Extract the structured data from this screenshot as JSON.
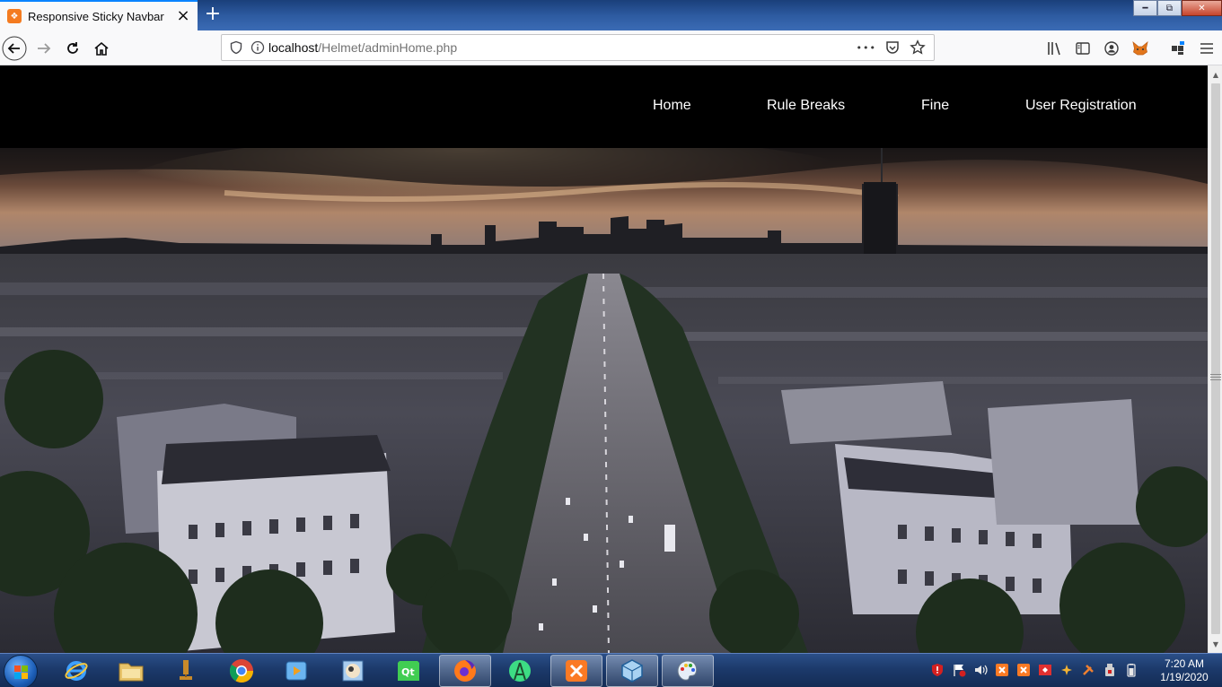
{
  "browser": {
    "tab": {
      "title": "Responsive Sticky Navbar",
      "favicon": "xampp-icon"
    },
    "new_tab": "+",
    "url": {
      "host": "localhost",
      "path": "/Helmet/adminHome.php"
    },
    "page_actions": "•••",
    "window_controls": [
      "minimize",
      "restore",
      "close"
    ]
  },
  "site": {
    "nav": [
      "Home",
      "Rule Breaks",
      "Fine",
      "User Registration"
    ],
    "hero": "aerial-city-skyline-image"
  },
  "taskbar": {
    "apps": [
      "internet-explorer",
      "file-explorer",
      "server-tool",
      "chrome",
      "media-player",
      "photo-viewer",
      "qt-creator",
      "firefox",
      "android-studio",
      "xampp",
      "virtualbox",
      "paint"
    ],
    "active_app": "xampp",
    "clock": {
      "time": "7:20 AM",
      "date": "1/19/2020"
    }
  },
  "colors": {
    "accent": "#0a84ff",
    "site_nav_bg": "#000000",
    "taskbar": "#1c3a6b"
  }
}
